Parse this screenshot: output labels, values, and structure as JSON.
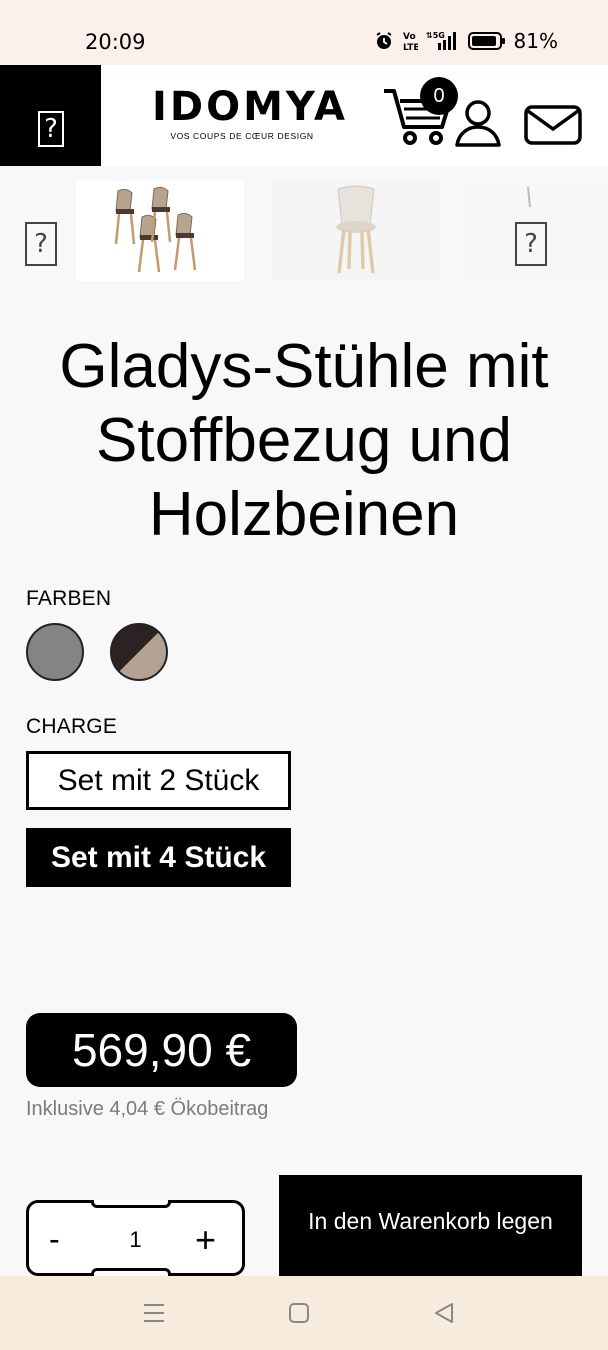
{
  "status_bar": {
    "time": "20:09",
    "battery": "81%",
    "icons": [
      "alarm-icon",
      "volte-icon",
      "5g-signal-icon",
      "battery-icon"
    ]
  },
  "header": {
    "logo_text": "IDOMYA",
    "logo_tagline": "VOS COUPS DE CŒUR DESIGN",
    "cart_count": "0",
    "menu_icon": "question-icon",
    "icons": [
      "cart-icon",
      "user-icon",
      "mail-icon"
    ]
  },
  "gallery": {
    "placeholder_glyph": "?"
  },
  "product": {
    "title": "Gladys-Stühle mit Stoffbezug und Holzbeinen",
    "colors_label": "FARBEN",
    "colors": [
      {
        "name": "grey",
        "hex": "#848484"
      },
      {
        "name": "brown-beige",
        "hex_a": "#2a2322",
        "hex_b": "#b3a294"
      }
    ],
    "charge_label": "CHARGE",
    "options": [
      {
        "label": "Set mit 2 Stück",
        "selected": false
      },
      {
        "label": "Set mit 4 Stück",
        "selected": true
      }
    ],
    "price": "569,90 €",
    "eco_note": "Inklusive 4,04 € Ökobeitrag"
  },
  "purchase": {
    "qty_minus": "-",
    "qty_value": "1",
    "qty_plus": "+",
    "add_to_cart": "In den Warenkorb legen"
  },
  "nav": {
    "buttons": [
      "menu-nav-icon",
      "home-nav-icon",
      "back-nav-icon"
    ]
  }
}
